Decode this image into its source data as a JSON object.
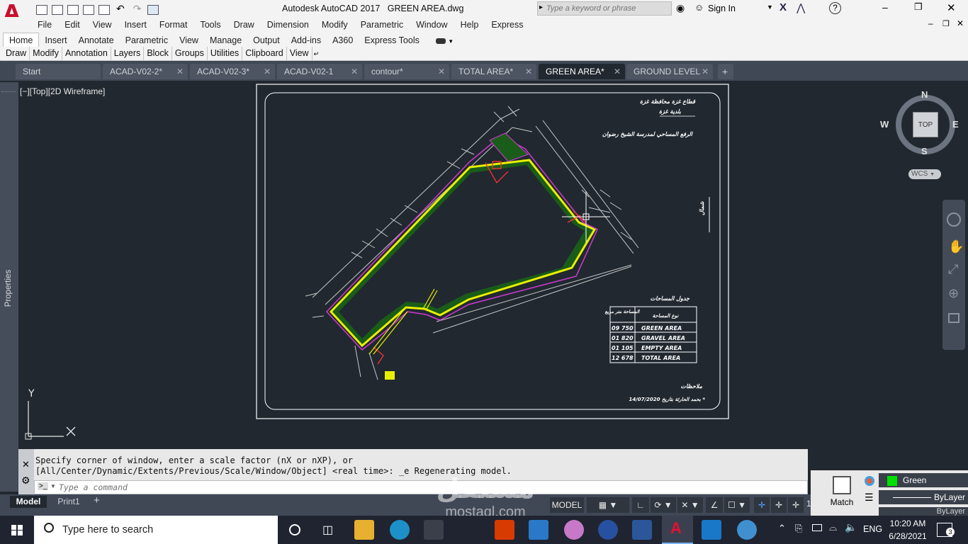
{
  "titlebar": {
    "app_title": "Autodesk AutoCAD 2017",
    "file_name": "GREEN AREA.dwg",
    "search_placeholder": "Type a keyword or phrase",
    "sign_in": "Sign In",
    "logo_letter": "A"
  },
  "menu": [
    "File",
    "Edit",
    "View",
    "Insert",
    "Format",
    "Tools",
    "Draw",
    "Dimension",
    "Modify",
    "Parametric",
    "Window",
    "Help",
    "Express"
  ],
  "ribbon_tabs": [
    "Home",
    "Insert",
    "Annotate",
    "Parametric",
    "View",
    "Manage",
    "Output",
    "Add-ins",
    "A360",
    "Express Tools"
  ],
  "ribbon_panels": [
    "Draw",
    "Modify",
    "Annotation",
    "Layers",
    "Block",
    "Groups",
    "Utilities",
    "Clipboard",
    "View"
  ],
  "file_tabs": [
    "Start",
    "ACAD-V02-2*",
    "ACAD-V02-3*",
    "ACAD-V02-1",
    "contour*",
    "TOTAL AREA*",
    "GREEN AREA*",
    "GROUND LEVEL"
  ],
  "active_file_tab": "GREEN AREA*",
  "viewport": {
    "label": "[−][Top][2D Wireframe]",
    "properties_label": "Properties",
    "ucs_y": "Y"
  },
  "viewcube": {
    "n": "N",
    "s": "S",
    "e": "E",
    "w": "W",
    "top": "TOP",
    "wcs": "WCS"
  },
  "drawing": {
    "header_lines": [
      "قطاع غزة   محافظة غزة",
      "بلدية غزة",
      "الرفع المساحي لمدرسة الشيخ رضوان"
    ],
    "table_title": "جدول المساحات",
    "table_header": [
      "المساحة متر مربع",
      "نوع المساحة"
    ],
    "table_rows": [
      [
        "09 750",
        "GREEN AREA"
      ],
      [
        "01 820",
        "GRAVEL AREA"
      ],
      [
        "01 105",
        "EMPTY AREA"
      ],
      [
        "12 678",
        "TOTAL AREA"
      ]
    ],
    "notes_label": "ملاحظات",
    "date_note": "14/07/2020 بحمد الحارثة بتاريخ *"
  },
  "command": {
    "line1": "Specify corner of window, enter a scale factor (nX or nXP), or",
    "line2": "[All/Center/Dynamic/Extents/Previous/Scale/Window/Object] <real time>: _e Regenerating model.",
    "placeholder": "Type a command"
  },
  "layout_tabs": [
    "Model",
    "Print1"
  ],
  "status": {
    "model": "MODEL"
  },
  "properties": {
    "color": "Green",
    "linetype": "ByLayer",
    "lineweight": "ByLayer",
    "match": "Match"
  },
  "taskbar": {
    "search_placeholder": "Type here to search",
    "language": "ENG",
    "time": "10:20 AM",
    "date": "6/28/2021",
    "notifications": "3"
  },
  "watermark": {
    "arabic": "مستقل",
    "latin": "mostaql.com"
  },
  "colors": {
    "accent_red": "#c8102e",
    "viewport_bg": "#212830",
    "green_area": "#1a5c1a",
    "yellow": "#e8f000"
  }
}
